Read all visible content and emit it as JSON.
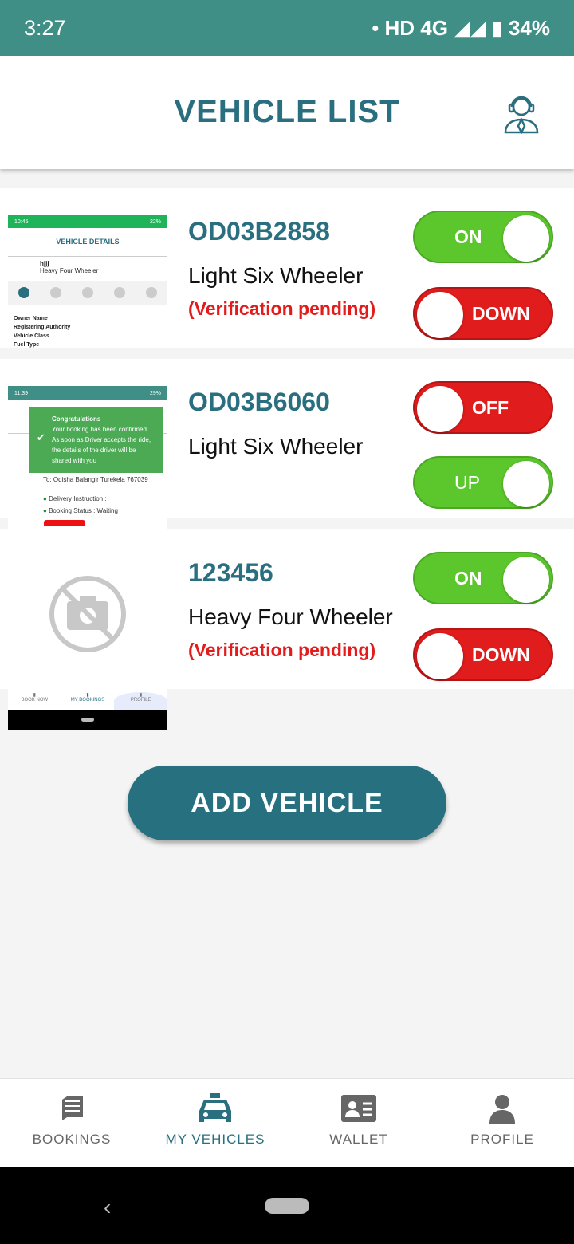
{
  "status_bar": {
    "time": "3:27",
    "network": "HD 4G",
    "battery": "34%"
  },
  "header": {
    "title": "VEHICLE LIST",
    "support_icon": "customer-support-icon"
  },
  "vehicles": [
    {
      "plate": "OD03B2858",
      "type": "Light Six Wheeler",
      "verification": "(Verification pending)",
      "status_toggle": "ON",
      "direction_toggle": "DOWN",
      "thumb": {
        "time": "10:45",
        "battery": "22%",
        "title": "VEHICLE DETAILS",
        "name": "hjjj",
        "type": "Heavy Four Wheeler",
        "steps": [
          "1",
          "2",
          "3",
          "4",
          "5"
        ],
        "fields": [
          "Owner Name",
          "Registering Authority",
          "Vehicle Class",
          "Fuel Type"
        ]
      }
    },
    {
      "plate": "OD03B6060",
      "type": "Light Six Wheeler",
      "verification": "",
      "status_toggle": "OFF",
      "direction_toggle": "UP",
      "thumb": {
        "time": "11:39",
        "battery": "29%",
        "toast_title": "Congratulations",
        "toast_body": "Your booking has been confirmed. As soon as Driver accepts the ride, the details of the driver will be shared with you",
        "address": "To: Odisha Balangir Turekela 767039",
        "delivery": "Delivery Instruction :",
        "booking_status": "Booking Status : Waiting"
      }
    },
    {
      "plate": "123456",
      "type": "Heavy Four Wheeler",
      "verification": "(Verification pending)",
      "status_toggle": "ON",
      "direction_toggle": "DOWN",
      "thumb": {
        "nav": [
          "BOOK NOW",
          "MY BOOKINGS",
          "PROFILE"
        ]
      }
    }
  ],
  "add_button": "ADD VEHICLE",
  "bottom_nav": [
    {
      "label": "BOOKINGS",
      "icon": "book-icon"
    },
    {
      "label": "MY VEHICLES",
      "icon": "taxi-icon",
      "active": true
    },
    {
      "label": "WALLET",
      "icon": "id-card-icon"
    },
    {
      "label": "PROFILE",
      "icon": "person-icon"
    }
  ],
  "colors": {
    "primary": "#2a6f80",
    "on": "#5cc72c",
    "off": "#e11c1c",
    "pending": "#e31b1b"
  }
}
